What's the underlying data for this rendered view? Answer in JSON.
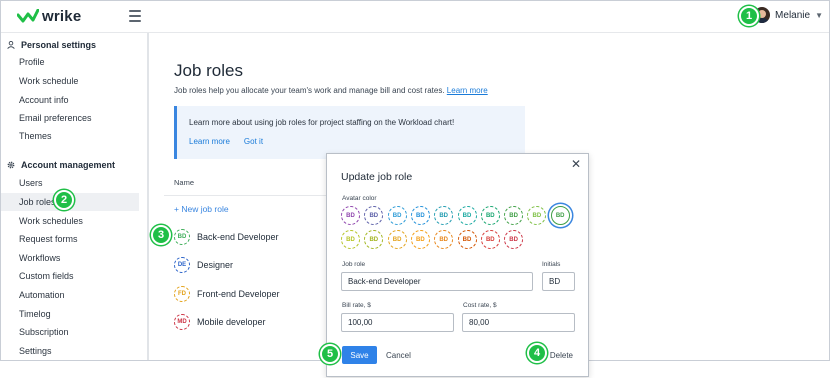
{
  "app": {
    "logo_text": "wrike",
    "user_name": "Melanie"
  },
  "markers": [
    "1",
    "2",
    "3",
    "4",
    "5"
  ],
  "sidebar": {
    "personal_title": "Personal settings",
    "personal_items": [
      "Profile",
      "Work schedule",
      "Account info",
      "Email preferences",
      "Themes"
    ],
    "account_title": "Account management",
    "account_items": [
      "Users",
      "Job roles",
      "Work schedules",
      "Request forms",
      "Workflows",
      "Custom fields",
      "Automation",
      "Timelog",
      "Subscription",
      "Settings"
    ],
    "active_item": "Job roles"
  },
  "main": {
    "title": "Job roles",
    "description": "Job roles help you allocate your team's work and manage bill and cost rates.",
    "learn_more": "Learn more",
    "info_text": "Learn more about using job roles for project staffing on the Workload chart!",
    "info_learn_more": "Learn more",
    "info_got_it": "Got it",
    "column_name": "Name",
    "new_role": "+ New job role",
    "roles": [
      {
        "initials": "BD",
        "name": "Back-end Developer",
        "color": "#3fae5a"
      },
      {
        "initials": "DE",
        "name": "Designer",
        "color": "#2b63c9"
      },
      {
        "initials": "FD",
        "name": "Front-end Developer",
        "color": "#e3a21a"
      },
      {
        "initials": "MD",
        "name": "Mobile developer",
        "color": "#cc3344"
      }
    ]
  },
  "modal": {
    "title": "Update job role",
    "close_glyph": "✕",
    "avatar_color_label": "Avatar color",
    "avatar_initials": "BD",
    "colors_row1": [
      "#8e44ad",
      "#5b5fa8",
      "#2b9bd6",
      "#1f8fd9",
      "#1f9bb0",
      "#17a8a0",
      "#16a56f",
      "#3f9f45",
      "#7cbf42",
      "#3f9f45"
    ],
    "colors_row2": [
      "#b5c324",
      "#a3b51f",
      "#e3a21a",
      "#f39c12",
      "#e8861a",
      "#d35400",
      "#d63a36",
      "#cc3344"
    ],
    "selected_color_index": 9,
    "job_role_label": "Job role",
    "job_role_value": "Back-end Developer",
    "initials_label": "Initials",
    "initials_value": "BD",
    "bill_rate_label": "Bill rate, $",
    "bill_rate_value": "100,00",
    "cost_rate_label": "Cost rate, $",
    "cost_rate_value": "80,00",
    "save_label": "Save",
    "cancel_label": "Cancel",
    "delete_label": "Delete"
  }
}
